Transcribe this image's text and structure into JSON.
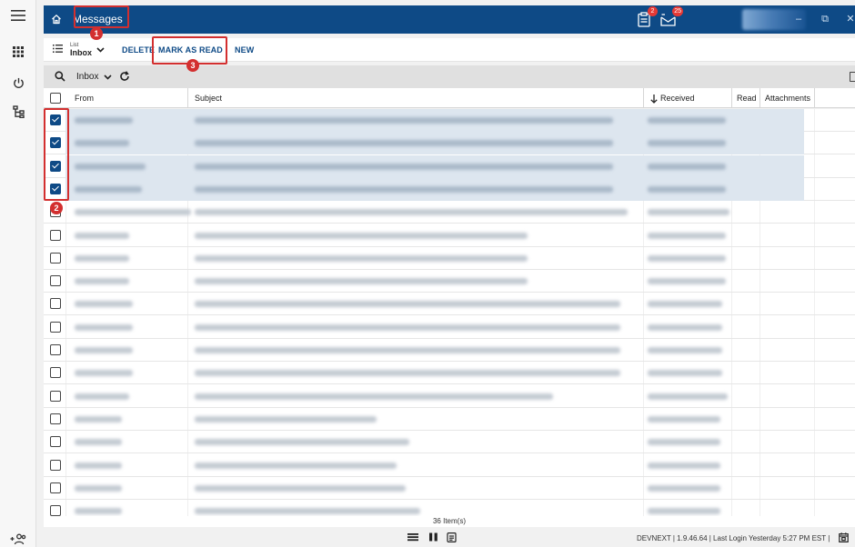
{
  "app": {
    "title": "Messages"
  },
  "titlebar": {
    "notif_count": "2",
    "inbox_count": "25",
    "minimize": "–",
    "restore": "⧉",
    "close": "✕"
  },
  "toolbar": {
    "view_label_top": "List",
    "view_label_bottom": "Inbox",
    "delete_label": "DELETE",
    "mark_read_label": "MARK AS READ",
    "new_label": "NEW"
  },
  "folder": {
    "selected": "Inbox"
  },
  "columns": {
    "from": "From",
    "subject": "Subject",
    "received": "Received",
    "read": "Read",
    "attachments": "Attachments"
  },
  "rows_checked": [
    true,
    true,
    true,
    true,
    false,
    false,
    false,
    false,
    false,
    false,
    false,
    false,
    false,
    false,
    false,
    false,
    false,
    false
  ],
  "footer": {
    "item_count": "36 Item(s)",
    "status": "DEVNEXT  |  1.9.46.64  |  Last Login Yesterday 5:27 PM EST  |"
  },
  "annotations": [
    "1",
    "2",
    "3"
  ],
  "colors": {
    "brand": "#0e4a86",
    "highlight": "#d32f2f",
    "selected_row": "#dde6ef"
  }
}
